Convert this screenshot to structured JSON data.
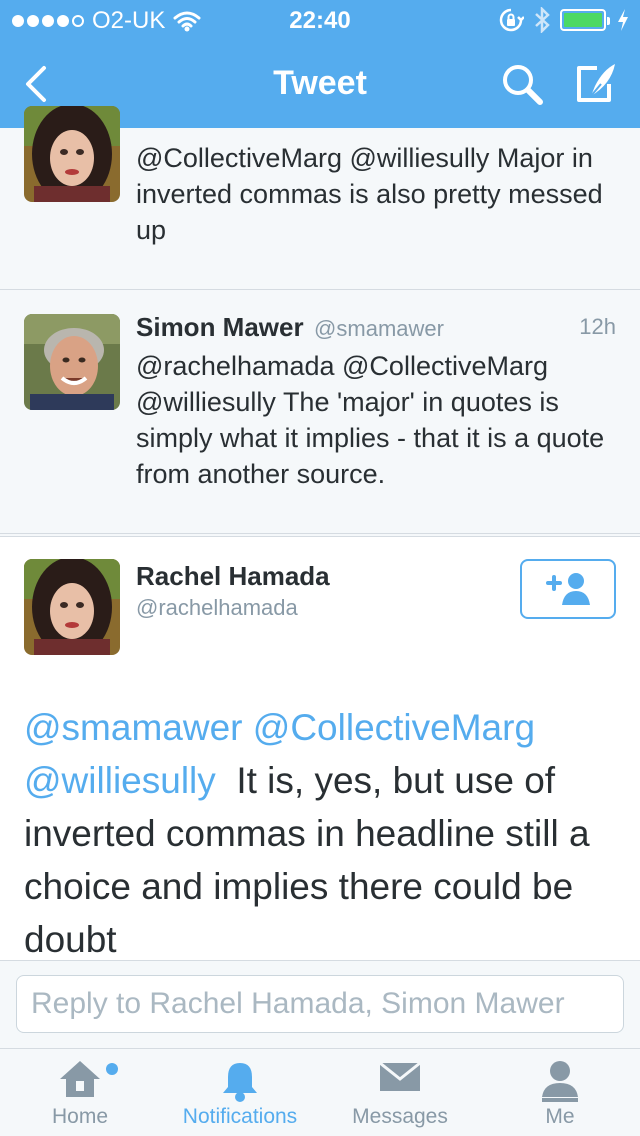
{
  "status_bar": {
    "carrier": "O2-UK",
    "time": "22:40",
    "signal_filled": 4,
    "signal_total": 5
  },
  "nav": {
    "title": "Tweet",
    "back_icon": "chevron-left-icon",
    "search_icon": "search-icon",
    "compose_icon": "compose-icon"
  },
  "tweets": [
    {
      "avatar_icon": "avatar",
      "text": "@CollectiveMarg @williesully Major in inverted commas is also pretty messed up"
    },
    {
      "name": "Simon Mawer",
      "handle": "@smamawer",
      "time": "12h",
      "text": "@rachelhamada @CollectiveMarg @williesully The 'major' in quotes is simply what it implies - that it is a quote from another source."
    }
  ],
  "main_tweet": {
    "name": "Rachel Hamada",
    "handle": "@rachelhamada",
    "mention_1": "@smamawer",
    "mention_2": "@CollectiveMarg",
    "mention_3": "@williesully",
    "body": "It is, yes, but use of inverted commas in headline still a choice and implies there could be doubt"
  },
  "reply": {
    "placeholder": "Reply to Rachel Hamada, Simon Mawer"
  },
  "tabs": [
    {
      "label": "Home",
      "icon": "home-icon",
      "active": false
    },
    {
      "label": "Notifications",
      "icon": "bell-icon",
      "active": true
    },
    {
      "label": "Messages",
      "icon": "envelope-icon",
      "active": false
    },
    {
      "label": "Me",
      "icon": "person-icon",
      "active": false
    }
  ],
  "colors": {
    "brand": "#55acee",
    "text": "#292f33",
    "muted": "#8899a6",
    "background_alt": "#f5f8fa"
  }
}
